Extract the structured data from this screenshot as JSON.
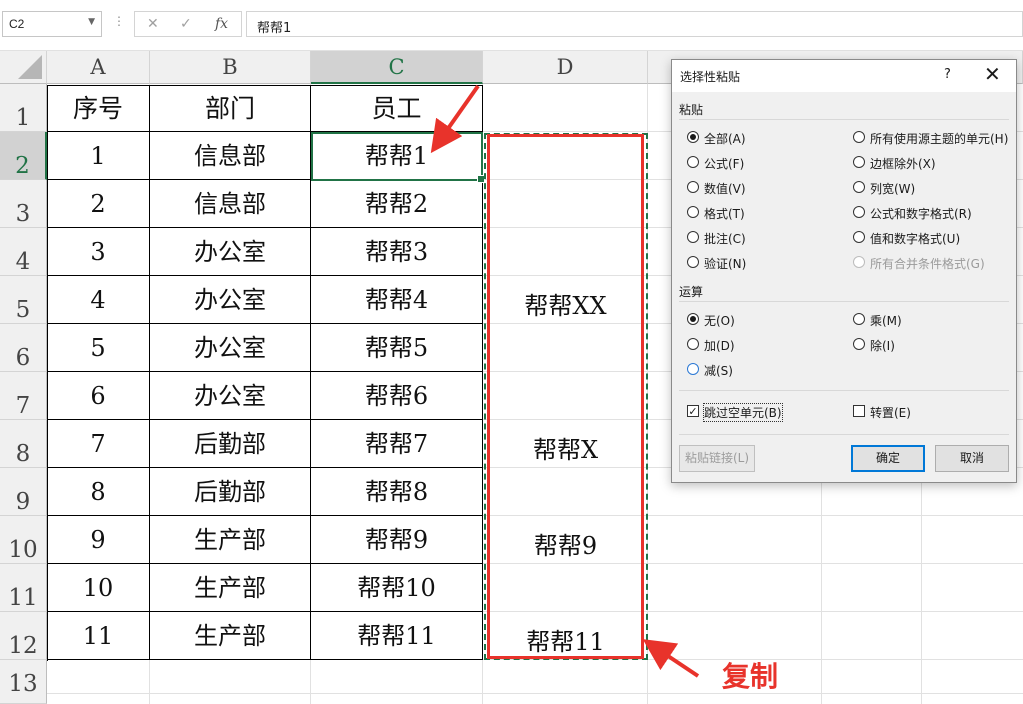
{
  "formula_bar": {
    "name_box": "C2",
    "dots": "⋮",
    "cancel_icon": "✕",
    "enter_icon": "✓",
    "fx_icon": "fx",
    "formula": "帮帮1"
  },
  "columns": [
    "A",
    "B",
    "C",
    "D"
  ],
  "rows": [
    "1",
    "2",
    "3",
    "4",
    "5",
    "6",
    "7",
    "8",
    "9",
    "10",
    "11",
    "12",
    "13"
  ],
  "table": {
    "headers": [
      "序号",
      "部门",
      "员工"
    ],
    "rows": [
      [
        "1",
        "信息部",
        "帮帮1"
      ],
      [
        "2",
        "信息部",
        "帮帮2"
      ],
      [
        "3",
        "办公室",
        "帮帮3"
      ],
      [
        "4",
        "办公室",
        "帮帮4"
      ],
      [
        "5",
        "办公室",
        "帮帮5"
      ],
      [
        "6",
        "办公室",
        "帮帮6"
      ],
      [
        "7",
        "后勤部",
        "帮帮7"
      ],
      [
        "8",
        "后勤部",
        "帮帮8"
      ],
      [
        "9",
        "生产部",
        "帮帮9"
      ],
      [
        "10",
        "生产部",
        "帮帮10"
      ],
      [
        "11",
        "生产部",
        "帮帮11"
      ]
    ]
  },
  "column_d": [
    {
      "row": "5",
      "value": "帮帮XX"
    },
    {
      "row": "8",
      "value": "帮帮X"
    },
    {
      "row": "10",
      "value": "帮帮9"
    },
    {
      "row": "12",
      "value": "帮帮11"
    }
  ],
  "annotation": {
    "copy_label": "复制",
    "arrow_color": "#e8332b"
  },
  "dialog": {
    "title": "选择性粘贴",
    "help": "?",
    "close": "✕",
    "paste_group": "粘贴",
    "paste_left": [
      "全部(A)",
      "公式(F)",
      "数值(V)",
      "格式(T)",
      "批注(C)",
      "验证(N)"
    ],
    "paste_right": [
      "所有使用源主题的单元(H)",
      "边框除外(X)",
      "列宽(W)",
      "公式和数字格式(R)",
      "值和数字格式(U)",
      "所有合并条件格式(G)"
    ],
    "paste_selected": "全部(A)",
    "op_group": "运算",
    "op_left": [
      "无(O)",
      "加(D)",
      "减(S)"
    ],
    "op_right": [
      "乘(M)",
      "除(I)"
    ],
    "op_selected": "无(O)",
    "skip_blanks": {
      "label": "跳过空单元(B)",
      "checked": true
    },
    "transpose": {
      "label": "转置(E)",
      "checked": false
    },
    "paste_link_button": "粘贴链接(L)",
    "ok_button": "确定",
    "cancel_button": "取消"
  },
  "colors": {
    "excel_green": "#217346",
    "accent_blue": "#0078d7",
    "red": "#e8332b"
  }
}
